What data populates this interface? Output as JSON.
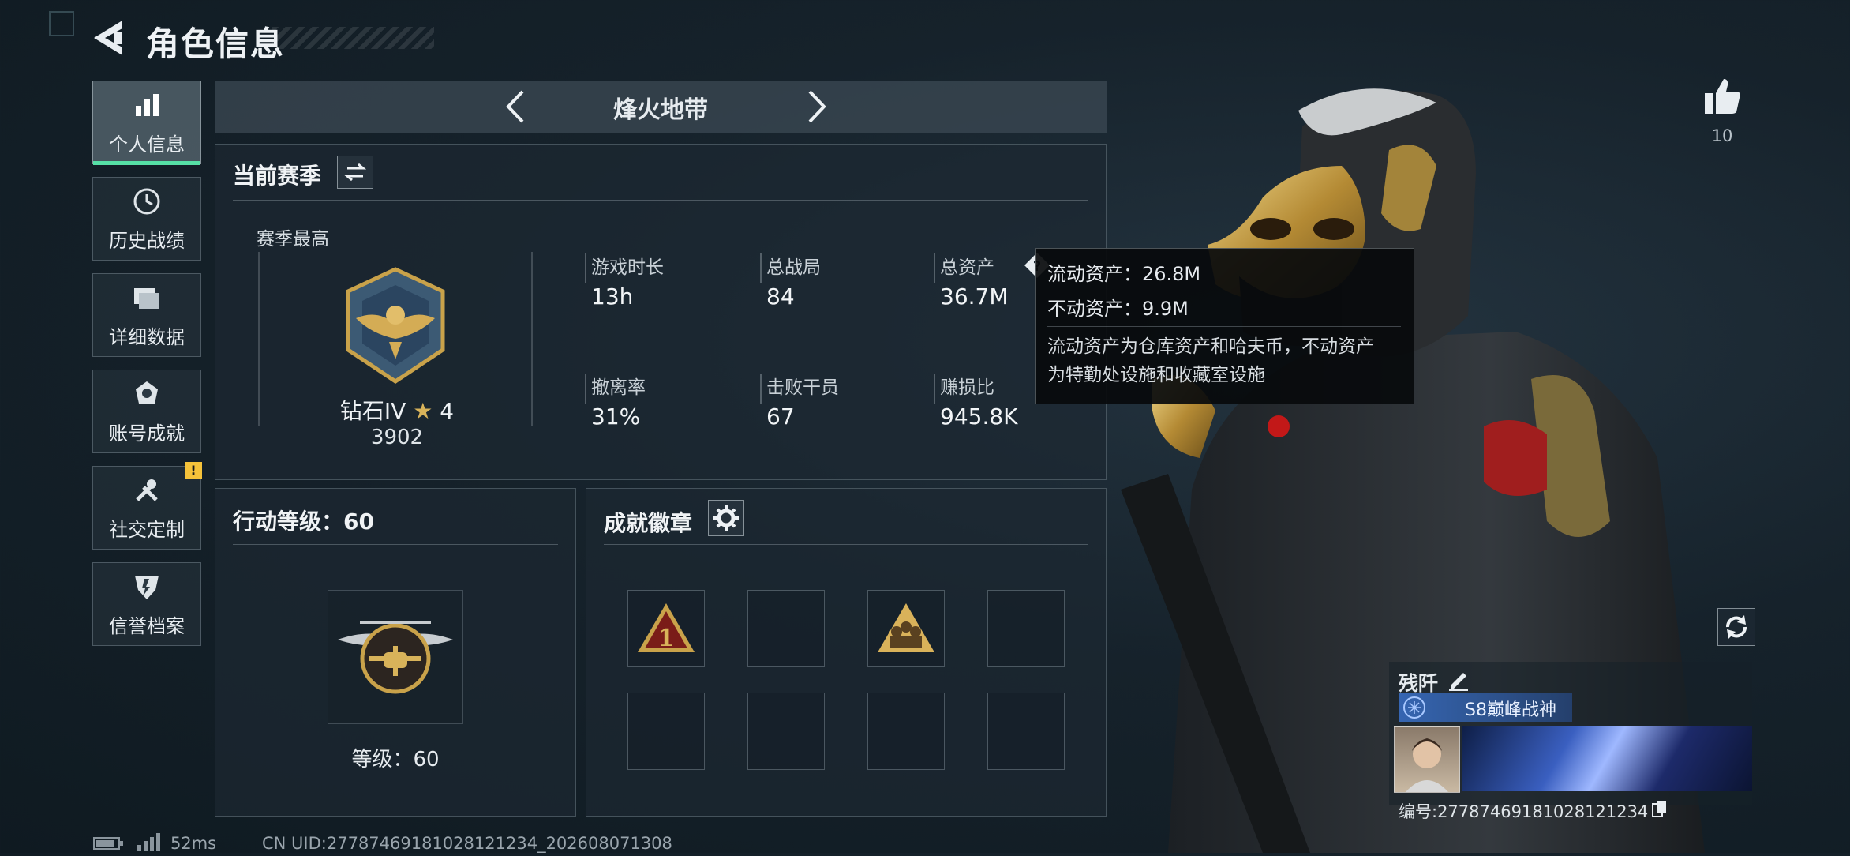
{
  "header": {
    "title": "角色信息",
    "back_icon": "back-arrow-icon"
  },
  "sidebar": {
    "items": [
      {
        "label": "个人信息",
        "icon": "bar-chart-icon",
        "active": true
      },
      {
        "label": "历史战绩",
        "icon": "clock-icon"
      },
      {
        "label": "详细数据",
        "icon": "folder-icon"
      },
      {
        "label": "账号成就",
        "icon": "medal-icon"
      },
      {
        "label": "社交定制",
        "icon": "tools-icon",
        "badge": "!"
      },
      {
        "label": "信誉档案",
        "icon": "shield-icon"
      }
    ]
  },
  "mode": {
    "title": "烽火地带"
  },
  "season": {
    "title": "当前赛季",
    "best_label": "赛季最高",
    "rank_name": "钻石IV",
    "rank_stars": "4",
    "rank_score": "3902",
    "stats": [
      {
        "label": "游戏时长",
        "value": "13h"
      },
      {
        "label": "总战局",
        "value": "84"
      },
      {
        "label": "总资产",
        "value": "36.7M"
      },
      {
        "label": "撤离率",
        "value": "31%"
      },
      {
        "label": "击败干员",
        "value": "67"
      },
      {
        "label": "赚损比",
        "value": "945.8K"
      }
    ]
  },
  "tooltip": {
    "line1": "流动资产：26.8M",
    "line2": "不动资产：9.9M",
    "note_line1": "流动资产为仓库资产和哈夫币，不动资产",
    "note_line2": "为特勤处设施和收藏室设施"
  },
  "action_level": {
    "title": "行动等级：60",
    "level_text": "等级：60"
  },
  "achievements": {
    "title": "成就徽章",
    "badge1": "1"
  },
  "likes": {
    "count": "10"
  },
  "player": {
    "name": "残阡",
    "title": "S8巅峰战神",
    "id": "编号:2778746918102812123​4"
  },
  "footer": {
    "ping": "52ms",
    "uid": "CN UID:27787469181028121234_202608071308"
  },
  "colors": {
    "accent": "#56e0a6",
    "warning": "#f5c23a",
    "gold": "#c9a24a"
  }
}
